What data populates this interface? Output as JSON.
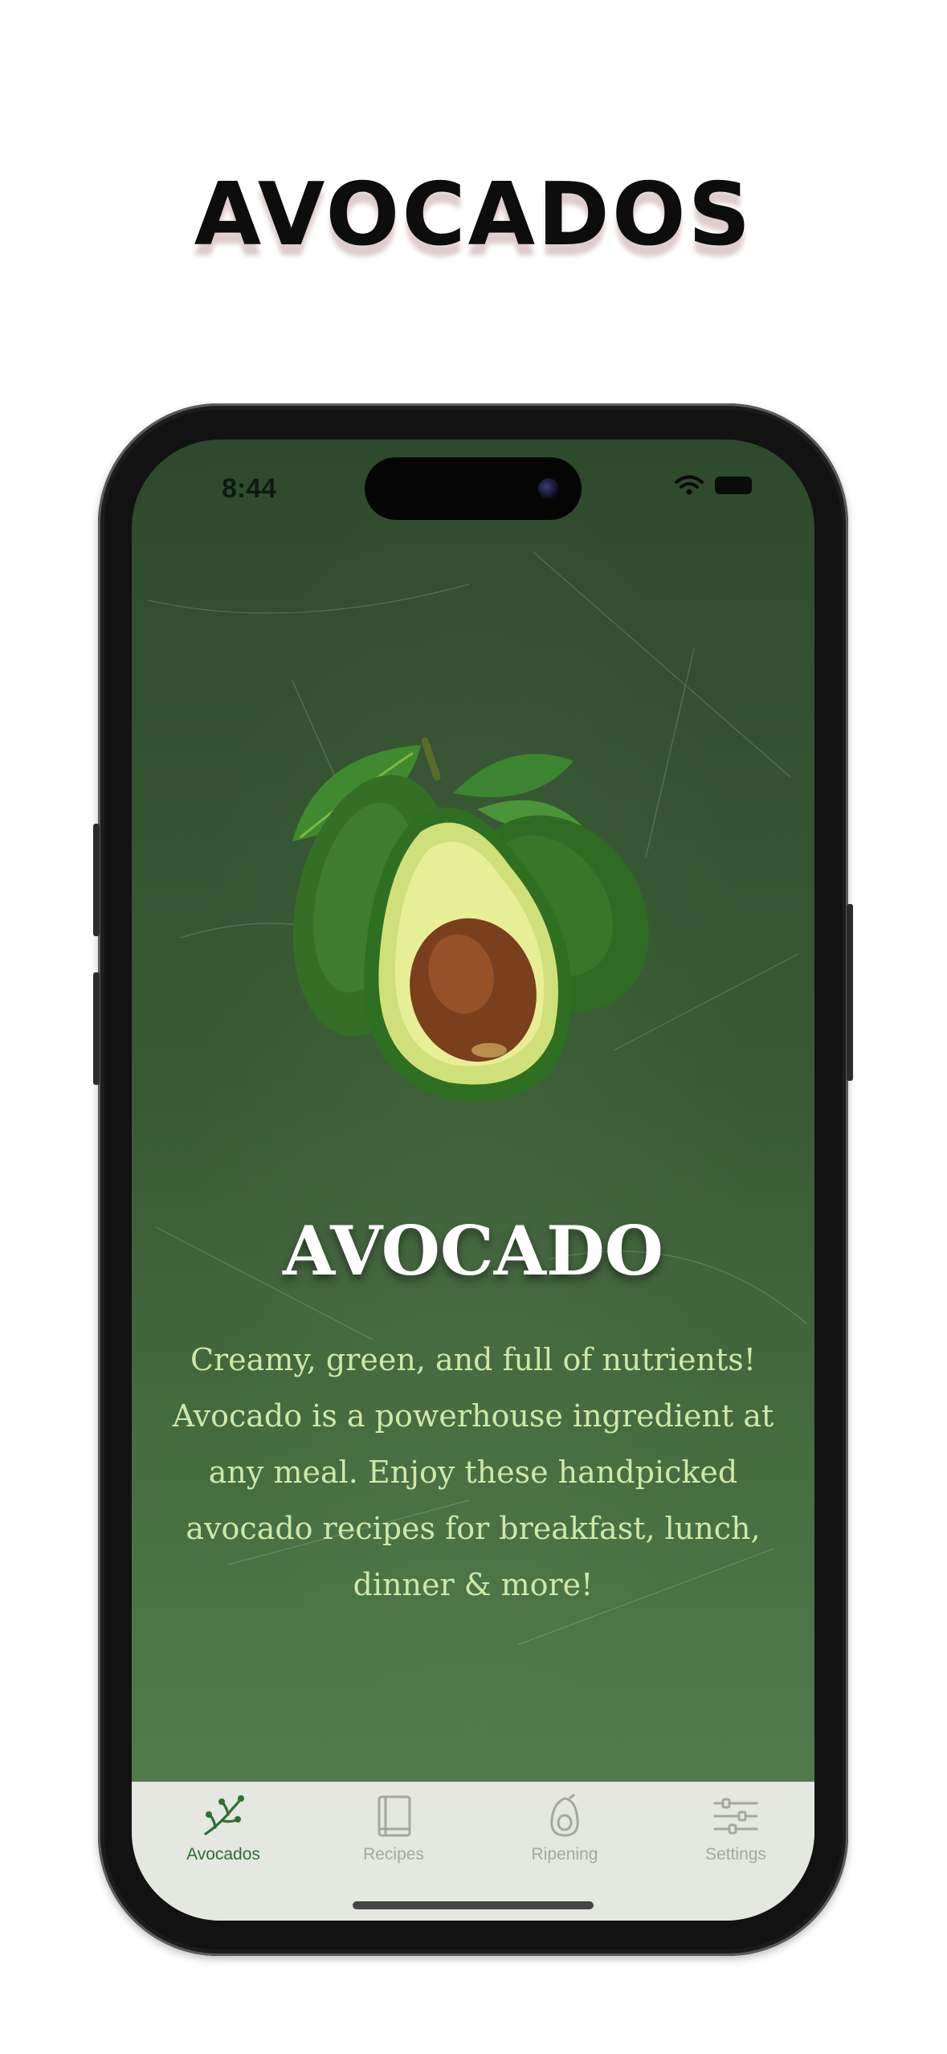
{
  "promo": {
    "title": "AVOCADOS"
  },
  "status_bar": {
    "time": "8:44"
  },
  "main": {
    "heading": "AVOCADO",
    "description": "Creamy, green, and full of nutrients! Avocado is a powerhouse ingredient at any meal. Enjoy these handpicked avocado recipes for breakfast, lunch, dinner & more!"
  },
  "tabbar": {
    "items": [
      {
        "label": "Avocados",
        "icon": "branch-icon",
        "active": true
      },
      {
        "label": "Recipes",
        "icon": "book-icon",
        "active": false
      },
      {
        "label": "Ripening",
        "icon": "avocado-icon",
        "active": false
      },
      {
        "label": "Settings",
        "icon": "sliders-icon",
        "active": false
      }
    ]
  },
  "colors": {
    "background_green": "#395a34",
    "accent": "#2f6e34",
    "description_text": "#cfe7a8",
    "tab_inactive": "#a4a8a2"
  }
}
